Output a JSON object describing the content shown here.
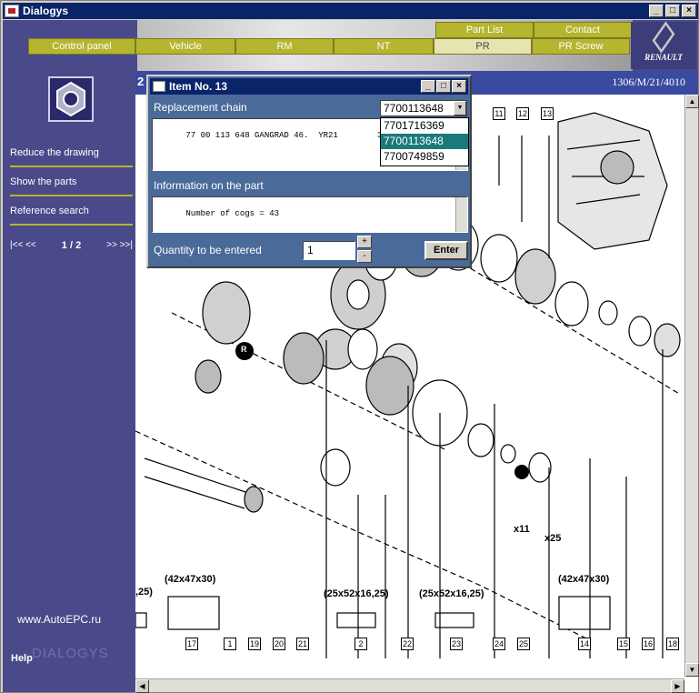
{
  "window": {
    "title": "Dialogys",
    "minimize": "_",
    "maximize": "□",
    "close": "×"
  },
  "nav": {
    "top_tabs": [
      "Part List",
      "Contact"
    ],
    "main_tabs": [
      "Control panel",
      "Vehicle",
      "RM",
      "NT",
      "PR",
      "PR Screw"
    ],
    "active_tab": "PR"
  },
  "brand": {
    "name": "RENAULT"
  },
  "sidebar": {
    "links": [
      "Reduce the drawing",
      "Show the parts",
      "Reference search"
    ],
    "pager": {
      "prev": "|<< <<",
      "current": "1 / 2",
      "next": ">> >>|"
    },
    "website": "www.AutoEPC.ru",
    "help": "Help",
    "watermark": "DIALOGYS"
  },
  "content": {
    "page_number": "2",
    "reference": "1306/M/21/4010",
    "ref_labels": [
      "11",
      "12",
      "13",
      "17",
      "1",
      "19",
      "20",
      "21",
      "2",
      "22",
      "23",
      "24",
      "25",
      "14",
      "15",
      "16",
      "18"
    ],
    "dimensions": [
      "(42x47x30)",
      "(25x52x16,25)",
      "(25x52x16,25)",
      "(42x47x30)",
      ",25)"
    ],
    "quantities": [
      "x11",
      "x25"
    ],
    "markers": [
      "R"
    ]
  },
  "dialog": {
    "title": "Item No. 13",
    "replacement_label": "Replacement chain",
    "selected_value": "7700113648",
    "options": [
      "7701716369",
      "7700113648",
      "7700749859"
    ],
    "chain_text": "77 00 113 648 GANGRAD 46.  YR21        323",
    "info_label": "Information on the part",
    "info_text": "Number of cogs = 43",
    "qty_label": "Quantity to be entered",
    "qty_value": "1",
    "spin_up": "+",
    "spin_down": "-",
    "enter_label": "Enter"
  }
}
